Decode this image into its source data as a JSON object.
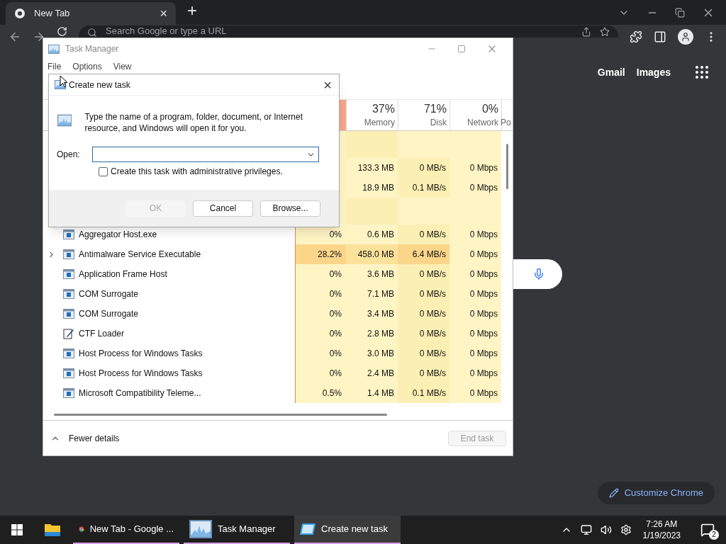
{
  "browser": {
    "tab": {
      "title": "New Tab",
      "close": "×",
      "selected": true
    },
    "new_tab": "+",
    "omnibox": {
      "placeholder": "Search Google or type a URL"
    },
    "links": [
      "Gmail",
      "Images"
    ],
    "customize_button": "Customize Chrome"
  },
  "task_manager": {
    "title": "Task Manager",
    "menu": [
      "File",
      "Options",
      "View"
    ],
    "columns": [
      {
        "percent": "37%",
        "label": "Memory"
      },
      {
        "percent": "71%",
        "label": "Disk"
      },
      {
        "percent": "0%",
        "label": "Network"
      },
      {
        "label": "Po"
      }
    ],
    "rows": [
      {
        "kind": "group"
      },
      {
        "kind": "app",
        "memory": "133.3 MB",
        "disk": "0 MB/s",
        "network": "0 Mbps",
        "hot": false
      },
      {
        "kind": "app",
        "memory": "18.9 MB",
        "disk": "0.1 MB/s",
        "network": "0 Mbps",
        "hot": false
      },
      {
        "kind": "group"
      },
      {
        "kind": "app",
        "expandable": false,
        "name": "Aggregator Host.exe",
        "cpu": "0%",
        "memory": "0.6 MB",
        "disk": "0 MB/s",
        "network": "0 Mbps",
        "hot": false
      },
      {
        "kind": "app",
        "expandable": true,
        "name": "Antimalware Service Executable",
        "cpu": "28.2%",
        "memory": "458.0 MB",
        "disk": "6.4 MB/s",
        "network": "0 Mbps",
        "hot": true
      },
      {
        "kind": "app",
        "expandable": false,
        "name": "Application Frame Host",
        "cpu": "0%",
        "memory": "3.6 MB",
        "disk": "0 MB/s",
        "network": "0 Mbps",
        "hot": false
      },
      {
        "kind": "app",
        "expandable": false,
        "name": "COM Surrogate",
        "cpu": "0%",
        "memory": "7.1 MB",
        "disk": "0 MB/s",
        "network": "0 Mbps",
        "hot": false
      },
      {
        "kind": "app",
        "expandable": false,
        "name": "COM Surrogate",
        "cpu": "0%",
        "memory": "3.4 MB",
        "disk": "0 MB/s",
        "network": "0 Mbps",
        "hot": false
      },
      {
        "kind": "pen",
        "expandable": false,
        "name": "CTF Loader",
        "cpu": "0%",
        "memory": "2.8 MB",
        "disk": "0 MB/s",
        "network": "0 Mbps",
        "hot": false
      },
      {
        "kind": "app",
        "expandable": false,
        "name": "Host Process for Windows Tasks",
        "cpu": "0%",
        "memory": "3.0 MB",
        "disk": "0 MB/s",
        "network": "0 Mbps",
        "hot": false
      },
      {
        "kind": "app",
        "expandable": false,
        "name": "Host Process for Windows Tasks",
        "cpu": "0%",
        "memory": "2.4 MB",
        "disk": "0 MB/s",
        "network": "0 Mbps",
        "hot": false
      },
      {
        "kind": "app",
        "expandable": false,
        "name": "Microsoft Compatibility Teleme...",
        "cpu": "0.5%",
        "memory": "1.4 MB",
        "disk": "0.1 MB/s",
        "network": "0 Mbps",
        "hot": false
      }
    ],
    "fewer_details": "Fewer details",
    "end_task": {
      "label": "End task",
      "disabled": true
    }
  },
  "dialog": {
    "title": "Create new task",
    "close": "×",
    "message": "Type the name of a program, folder, document, or Internet resource, and Windows will open it for you.",
    "open_label": "Open:",
    "admin_checkbox": {
      "label": "Create this task with administrative privileges.",
      "checked": false
    },
    "buttons": [
      {
        "label": "OK",
        "disabled": true
      },
      {
        "label": "Cancel",
        "disabled": false
      },
      {
        "label": "Browse...",
        "disabled": false
      }
    ]
  },
  "taskbar": {
    "apps": [
      {
        "kind": "browser",
        "label": "New Tab - Google ...",
        "selected": false
      },
      {
        "kind": "taskmanager",
        "label": "Task Manager",
        "selected": false
      },
      {
        "kind": "dialog",
        "label": "Create new task",
        "selected": true
      }
    ],
    "time": "7:26 AM",
    "date": "1/19/2023",
    "notifications": "2"
  }
}
